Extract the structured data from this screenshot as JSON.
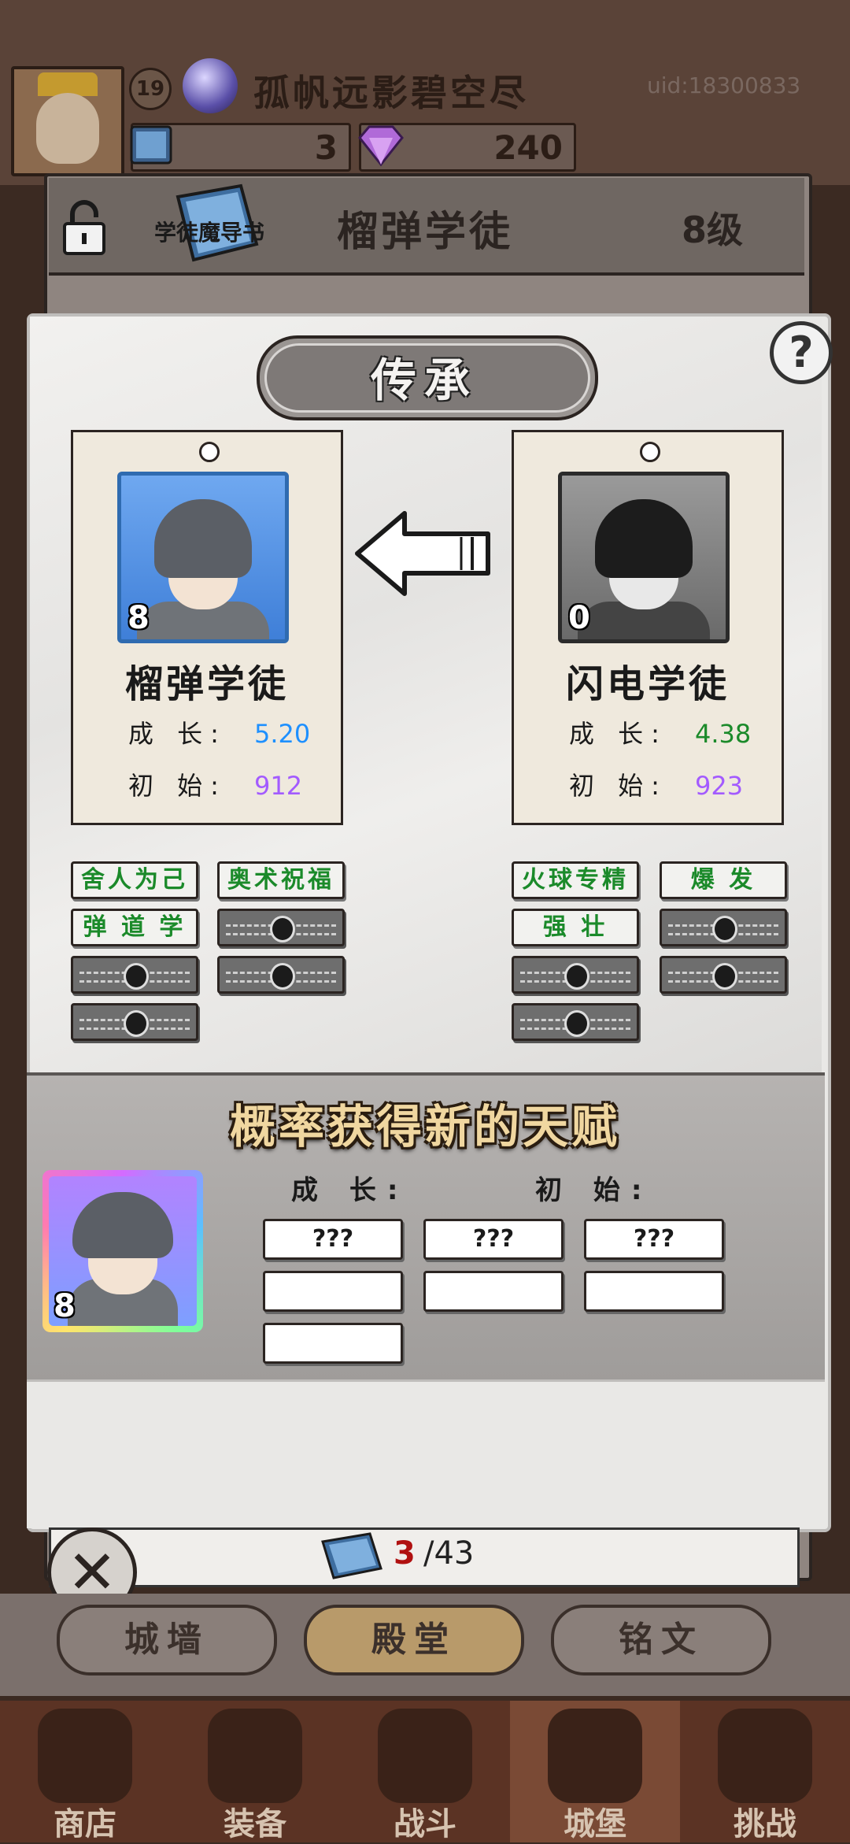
{
  "header": {
    "player_level": "19",
    "player_name": "孤帆远影碧空尽",
    "uid": "uid:18300833",
    "books": "3",
    "gems": "240"
  },
  "hero_panel": {
    "book_label": "学徒魔导书",
    "title": "榴弹学徒",
    "level": "8级"
  },
  "modal": {
    "title": "传承",
    "help": "?",
    "left_card": {
      "stars": "8",
      "name": "榴弹学徒",
      "growth_label": "成 长:",
      "growth_value": "5.20",
      "initial_label": "初 始:",
      "initial_value": "912"
    },
    "right_card": {
      "stars": "0",
      "name": "闪电学徒",
      "growth_label": "成 长:",
      "growth_value": "4.38",
      "initial_label": "初 始:",
      "initial_value": "923"
    },
    "left_talents": [
      "舍人为己",
      "奥术祝福",
      "弹 道 学"
    ],
    "right_talents": [
      "火球专精",
      "爆 发",
      "强 壮"
    ],
    "new_talent_title": "概率获得新的天赋",
    "result_stars": "8",
    "growth_header": "成 长:",
    "initial_header": "初 始:",
    "slots": [
      "???",
      "???",
      "???",
      "",
      "",
      "",
      ""
    ]
  },
  "bookbar": {
    "current": "3",
    "total": "/43"
  },
  "tabs": [
    "城墙",
    "殿堂",
    "铭文"
  ],
  "nav": [
    "商店",
    "装备",
    "战斗",
    "城堡",
    "挑战"
  ],
  "colors": {
    "growth_blue": "#1e90ff",
    "growth_green": "#1b8a2a",
    "initial_purple": "#a35bff",
    "talent_green": "#1b8a2a"
  }
}
